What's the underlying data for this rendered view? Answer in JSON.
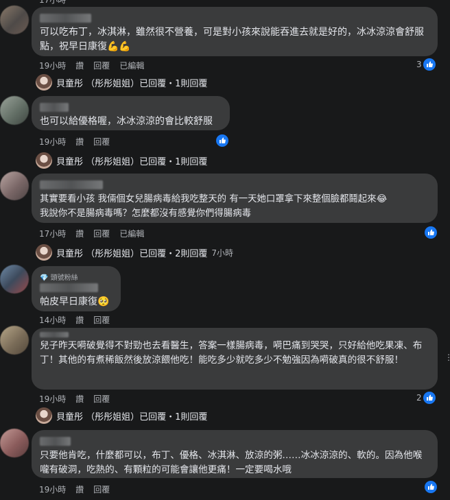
{
  "top_fragment": "17小時",
  "comments": [
    {
      "text": "可以吃布丁，冰淇淋，雖然很不營養，可是對小孩來說能吞進去就是好的，冰冰涼涼會舒服點，祝早日康復💪💪",
      "time": "19小時",
      "like": "讚",
      "reply": "回覆",
      "edited": "已編輯",
      "reactions": "3",
      "reply_summary": "貝童彤 （彤彤姐姐）已回覆・1則回覆"
    },
    {
      "text": "也可以給優格喔，冰冰涼涼的會比較舒服",
      "time": "19小時",
      "like": "讚",
      "reply": "回覆",
      "reactions": "",
      "reply_summary": "貝童彤 （彤彤姐姐）已回覆・1則回覆"
    },
    {
      "text": "其實要看小孩 我倆個女兒腸病毒給我吃整天的 有一天她口罩拿下來整個臉都鬪起來😂\n我說你不是腸病毒嗎？怎麼都沒有感覺你們得腸病毒",
      "time": "17小時",
      "like": "讚",
      "reply": "回覆",
      "edited": "已編輯",
      "reactions": "",
      "reply_summary": "貝童彤 （彤彤姐姐）已回覆・2則回覆",
      "reply_time": "7小時"
    },
    {
      "badge": "頭號粉絲",
      "text": "帕皮早日康復🥺",
      "time": "14小時",
      "like": "讚",
      "reply": "回覆"
    },
    {
      "text": "兒子昨天嗬破覺得不對勁也去看醫生，答案一樣腸病毒，嗬巴痛到哭哭，只好給他吃果凍、布丁！其他的有煮稀飯然後放涼餵他吃！能吃多少就吃多少不勉強因為嗬破真的很不舒服！",
      "time": "19小時",
      "like": "讚",
      "reply": "回覆",
      "reactions": "2",
      "reply_summary": "貝童彤 （彤彤姐姐）已回覆・1則回覆"
    },
    {
      "text": "只要他肯吃，什麼都可以，布丁、優格、冰淇淋、放涼的粥……冰冰涼涼的、軟的。因為他喉嚨有破洞，吃熱的、有顆粒的可能會讓他更痛！一定要喝水哦",
      "time": "19小時",
      "like": "讚",
      "reply": "回覆",
      "reactions": ""
    }
  ]
}
